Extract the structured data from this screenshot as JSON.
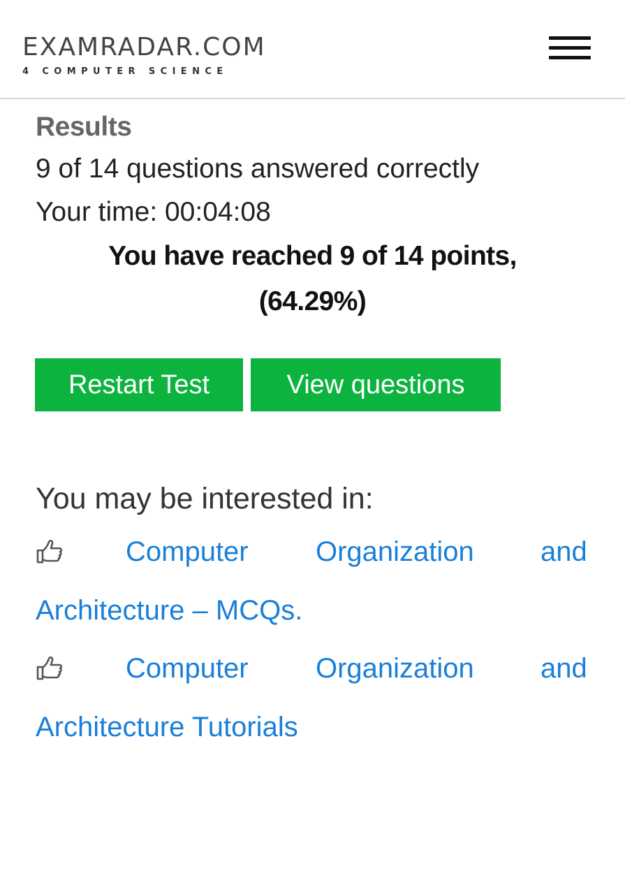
{
  "header": {
    "logo_title": "EXAMRADAR.COM",
    "logo_tagline": "4 COMPUTER SCIENCE",
    "menu_icon": "hamburger-menu-icon"
  },
  "results": {
    "title": "Results",
    "correct_text": "9 of 14 questions answered correctly",
    "time_text": "Your time: 00:04:08",
    "points_line1": "You have reached 9 of 14 points,",
    "points_line2": "(64.29%)"
  },
  "buttons": {
    "restart_label": "Restart Test",
    "view_label": "View questions",
    "color": "#0cb43f"
  },
  "related": {
    "heading": "You may be interested in:",
    "icon": "pointing-hand-icon",
    "link_color": "#1a7fd8",
    "links": [
      {
        "word1": "Computer",
        "word2": "Organization",
        "word3": "and",
        "continuation": "Architecture – MCQs."
      },
      {
        "word1": "Computer",
        "word2": "Organization",
        "word3": "and",
        "continuation": "Architecture Tutorials"
      }
    ]
  }
}
